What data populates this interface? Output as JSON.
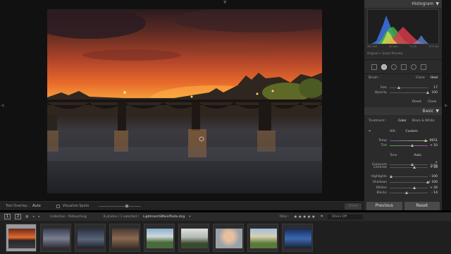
{
  "toolbar": {
    "tool_overlay_label": "Tool Overlay :",
    "tool_overlay_value": "Auto",
    "visualize_spots_label": "Visualize Spots",
    "done_label": "Done"
  },
  "histogram": {
    "title": "Histogram",
    "iso": "ISO 100",
    "focal": "40 mm",
    "aperture": "f / 20",
    "shutter": "13.0 sec",
    "preview_label": "Original + Smart Preview"
  },
  "brush": {
    "label": "Brush :",
    "clone": "Clone",
    "heal": "Heal",
    "size_label": "Size",
    "size_value": "17",
    "opacity_label": "Opacity",
    "opacity_value": "100",
    "reset": "Reset",
    "close": "Close"
  },
  "basic": {
    "title": "Basic",
    "treatment_label": "Treatment :",
    "color": "Color",
    "bw": "Black & White",
    "wb_label": "WB :",
    "wb_value": "Custom",
    "temp_label": "Temp",
    "temp_value": "9651",
    "tint_label": "Tint",
    "tint_value": "+ 10",
    "tone_label": "Tone",
    "tone_auto": "Auto",
    "sliders": [
      {
        "label": "Exposure",
        "value": "+ 0.55",
        "pos": 0.57
      },
      {
        "label": "Contrast",
        "value": "+ 28",
        "pos": 0.64
      },
      {
        "label": "Highlights",
        "value": "- 100",
        "pos": 0.0
      },
      {
        "label": "Shadows",
        "value": "+ 100",
        "pos": 1.0
      },
      {
        "label": "Whites",
        "value": "+ 26",
        "pos": 0.63
      },
      {
        "label": "Blacks",
        "value": "- 14",
        "pos": 0.43
      }
    ]
  },
  "buttons": {
    "previous": "Previous",
    "reset": "Reset"
  },
  "filmstrip": {
    "page1": "1",
    "page2": "2",
    "collection": "Collection : Retouching",
    "count": "8 photos / 1 selected /",
    "filename": "LightroomSMainPhoto.dng",
    "filter_label": "Filter :",
    "filter_value": "Filters Off"
  },
  "colors": {
    "accent": "#bbbbbb",
    "panel_bg": "#2b2b2b",
    "sky_orange": "#e86a2a"
  }
}
